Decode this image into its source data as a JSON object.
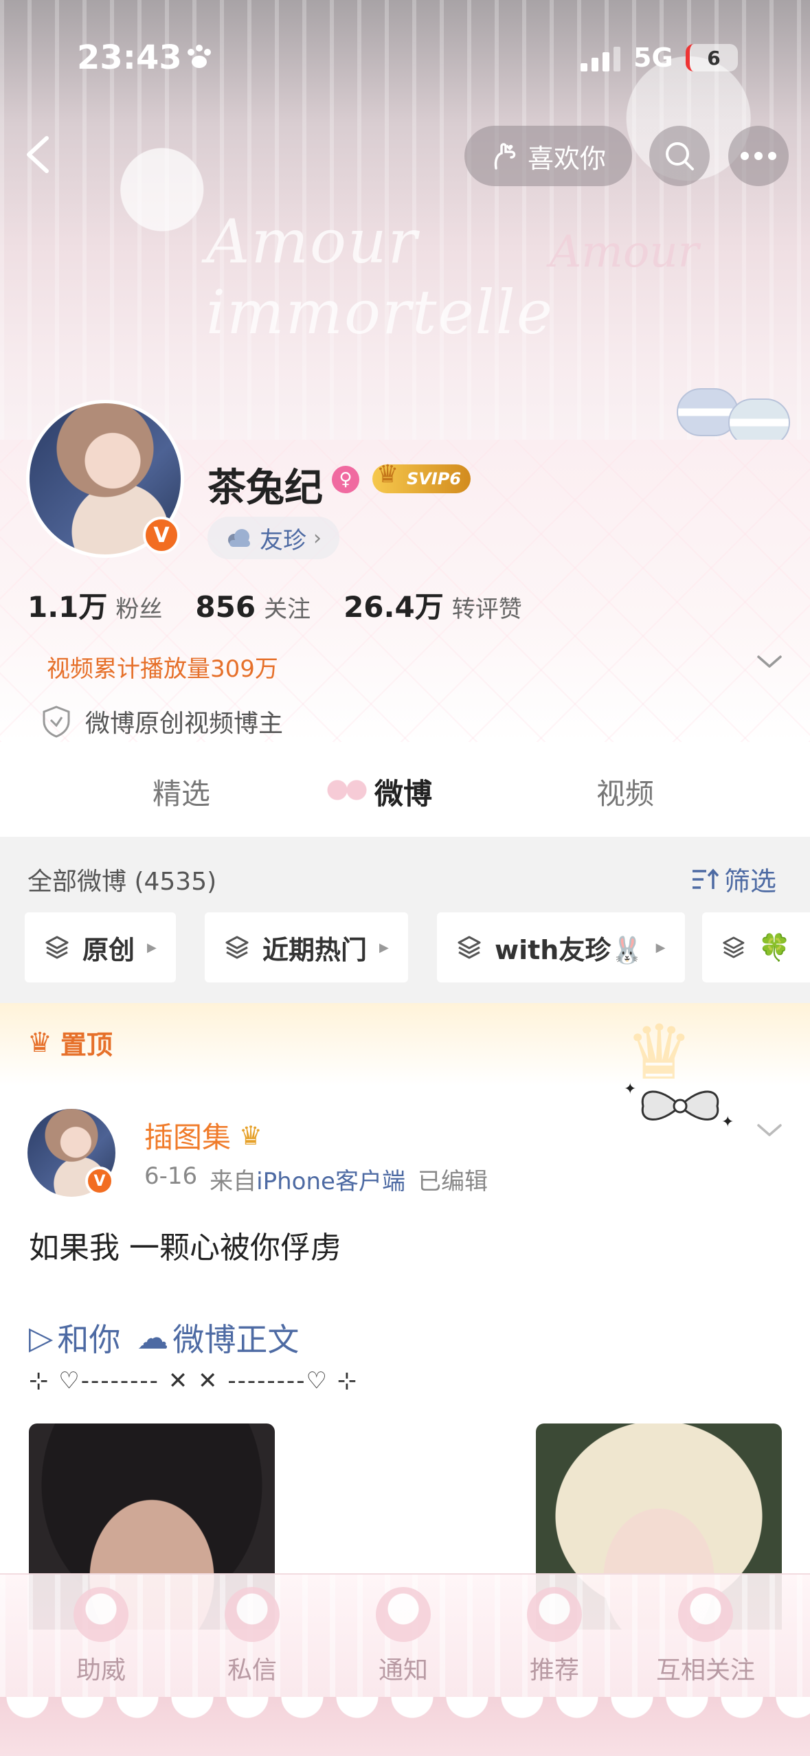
{
  "status_bar": {
    "time": "23:43",
    "network": "5G",
    "battery": "6"
  },
  "nav": {
    "like_label": "喜欢你"
  },
  "banner": {
    "script_text": "Amour immortelle",
    "script_text2": "Amour"
  },
  "profile": {
    "username": "茶兔纪",
    "vip_label": "SVIP6",
    "friend_label": "友珍",
    "stats": [
      {
        "value": "1.1万",
        "label": "粉丝"
      },
      {
        "value": "856",
        "label": "关注"
      },
      {
        "value": "26.4万",
        "label": "转评赞"
      }
    ],
    "video_plays": "视频累计播放量309万",
    "badge": "微博原创视频博主"
  },
  "tabs": [
    "精选",
    "微博",
    "视频"
  ],
  "feed": {
    "title": "全部微博 (4535)",
    "filter_label": "筛选",
    "chips": [
      "原创",
      "近期热门",
      "with友珍🐰",
      "🍀"
    ]
  },
  "pinned": {
    "label": "置顶",
    "author": "插图集",
    "date": "6-16",
    "source_prefix": "来自",
    "source": "iPhone客户端",
    "edited": "已编辑",
    "text": "如果我 一颗心被你俘虏",
    "link_text": "和你",
    "link_text2": "微博正文",
    "deco_line": "⊹ ♡-------- ✕ ✕ --------♡ ⊹"
  },
  "bottom_bar": [
    "助威",
    "私信",
    "通知",
    "推荐",
    "互相关注"
  ],
  "colors": {
    "accent_orange": "#e6702a",
    "link_blue": "#4d6aa3",
    "vip_gold": "#d28b1e"
  }
}
